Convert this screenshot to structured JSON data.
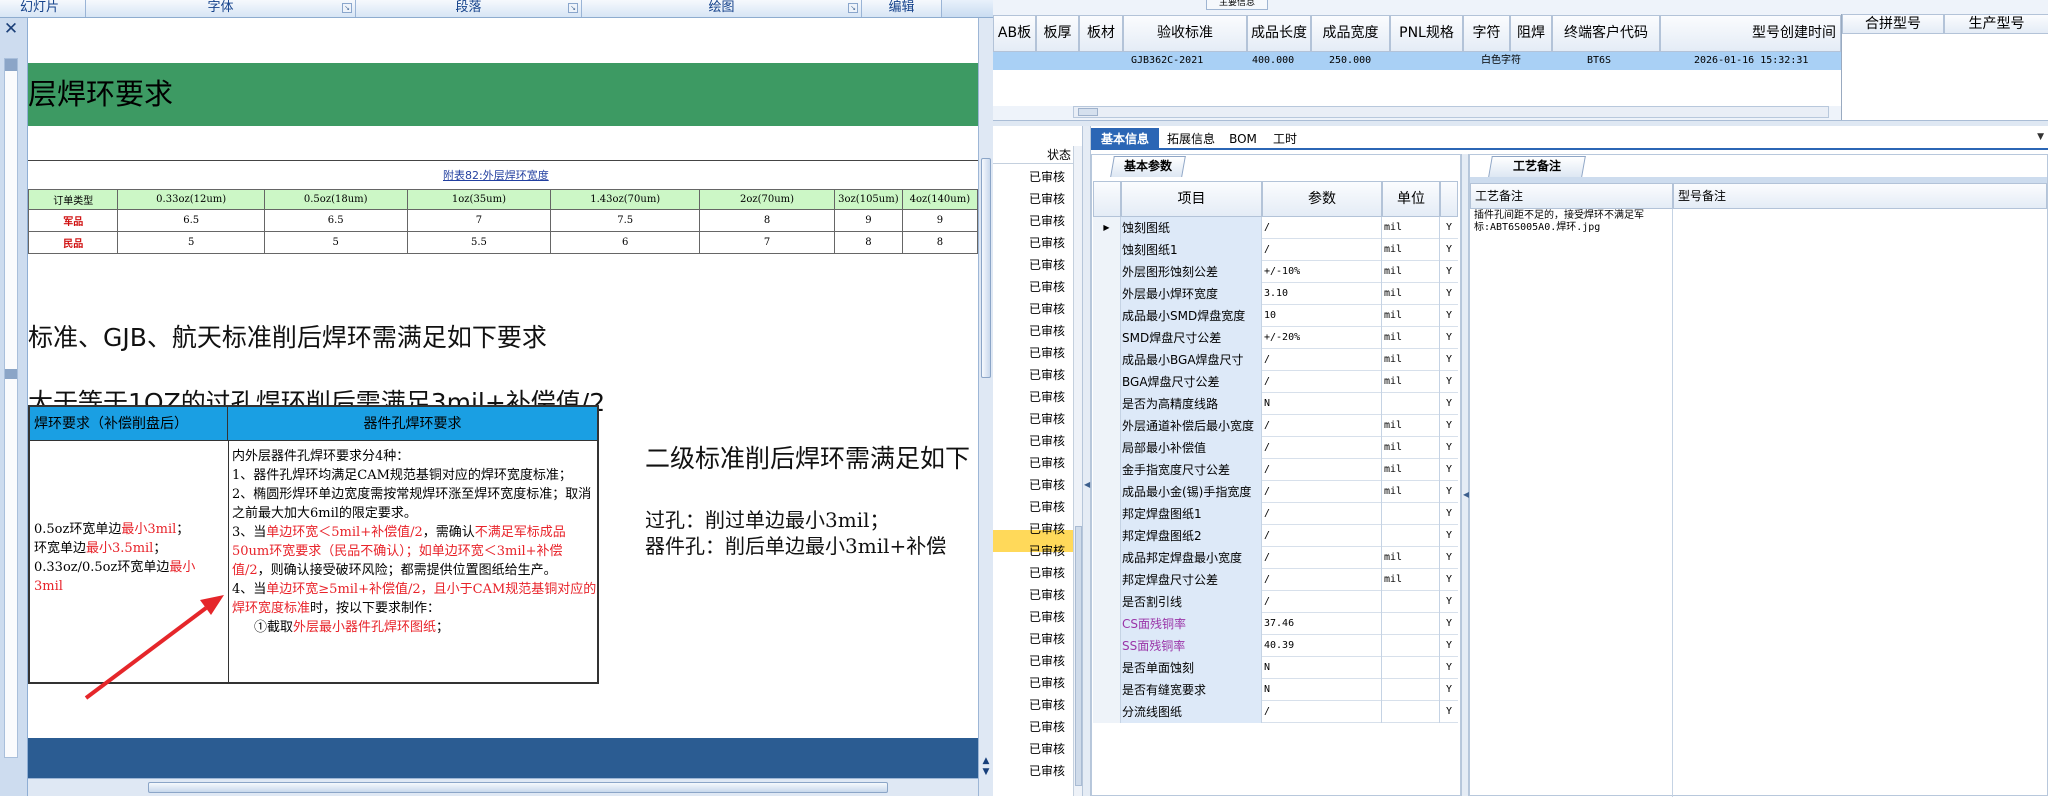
{
  "ribbon": {
    "groups": [
      "幻灯片",
      "字体",
      "段落",
      "绘图",
      "编辑"
    ]
  },
  "doc": {
    "heading": "层焊环要求",
    "table1_title": "附表82:外层焊环宽度",
    "table1": {
      "header": [
        "订单类型",
        "0.33oz(12um)",
        "0.5oz(18um)",
        "1oz(35um)",
        "1.43oz(70um)",
        "2oz(70um)",
        "3oz(105um)",
        "4oz(140um)"
      ],
      "rows": [
        [
          "军品",
          "6.5",
          "6.5",
          "7",
          "7.5",
          "8",
          "9",
          "9"
        ],
        [
          "民品",
          "5",
          "5",
          "5.5",
          "6",
          "7",
          "8",
          "8"
        ]
      ]
    },
    "para1": "标准、GJB、航天标准削后焊环需满足如下要求",
    "para2": "大于等于1OZ的过孔焊环削后需满足3mil+补偿值/2",
    "table2": {
      "head_left": "焊环要求（补偿削盘后）",
      "head_right": "器件孔焊环要求",
      "left_l1a": "0.5oz环宽单边",
      "left_l1b": "最小3mil",
      "left_l1c": "；",
      "left_l2a": "环宽单边",
      "left_l2b": "最小3.5mil",
      "left_l2c": "；",
      "left_l3a": "0.33oz/0.5oz环宽单边",
      "left_l3b": "最小3mil",
      "r1": "内外层器件孔焊环要求分4种：",
      "r2": "1、器件孔焊环均满足CAM规范基铜对应的焊环宽度标准；",
      "r3": "2、椭圆形焊环单边宽度需按常规焊环涨至焊环宽度标准；取消之前最大加大6mil的限定要求。",
      "r4a": "3、当",
      "r4b": "单边环宽＜5mil+补偿值/2",
      "r4c": "，需确认",
      "r4d": "不满足军标成品50um环宽要求（民品不确认）；如单边环宽＜3mil+补偿值/2",
      "r4e": "，则确认接受破环风险；都需提供位置图纸给生产。",
      "r5a": "4、当",
      "r5b": "单边环宽≥5mil+补偿值/2，且小于CAM规范基铜对应的焊环宽度标准",
      "r5c": "时，按以下要求制作：",
      "r6a": "①截取",
      "r6b": "外层最小器件孔焊环图纸",
      "r6c": "；"
    },
    "para3": "二级标准削后焊环需满足如下",
    "para4": "过孔：削过单边最小3mil；",
    "para5": "器件孔：削后单边最小3mil+补偿"
  },
  "erp": {
    "mini_tab": "主要信息",
    "grid_headers": [
      "AB板",
      "板厚",
      "板材",
      "验收标准",
      "成品长度",
      "成品宽度",
      "PNL规格",
      "字符",
      "阻焊",
      "终端客户代码",
      "型号创建时间"
    ],
    "grid_row": {
      "standard": "GJB362C-2021",
      "length": "400.000",
      "width": "250.000",
      "char": "白色字符",
      "customer": "BT6S",
      "created": "2026-01-16 15:32:31"
    },
    "merge_headers": [
      "合拼型号",
      "生产型号"
    ],
    "status_header": "状态",
    "status_value": "已审核",
    "tabs": [
      "基本信息",
      "拓展信息",
      "BOM",
      "工时"
    ],
    "basic_tab": "基本参数",
    "param_headers": [
      "项目",
      "参数",
      "单位"
    ],
    "params": [
      {
        "name": "蚀刻图纸",
        "value": "/",
        "unit": "mil",
        "flag": "Y"
      },
      {
        "name": "蚀刻图纸1",
        "value": "/",
        "unit": "mil",
        "flag": "Y"
      },
      {
        "name": "外层图形蚀刻公差",
        "value": "+/-10%",
        "unit": "mil",
        "flag": "Y"
      },
      {
        "name": "外层最小焊环宽度",
        "value": "3.10",
        "unit": "mil",
        "flag": "Y"
      },
      {
        "name": "成品最小SMD焊盘宽度",
        "value": "10",
        "unit": "mil",
        "flag": "Y"
      },
      {
        "name": "SMD焊盘尺寸公差",
        "value": "+/-20%",
        "unit": "mil",
        "flag": "Y"
      },
      {
        "name": "成品最小BGA焊盘尺寸",
        "value": "/",
        "unit": "mil",
        "flag": "Y"
      },
      {
        "name": "BGA焊盘尺寸公差",
        "value": "/",
        "unit": "mil",
        "flag": "Y"
      },
      {
        "name": "是否为高精度线路",
        "value": "N",
        "unit": "",
        "flag": "Y"
      },
      {
        "name": "外层通道补偿后最小宽度",
        "value": "/",
        "unit": "mil",
        "flag": "Y"
      },
      {
        "name": "局部最小补偿值",
        "value": "/",
        "unit": "mil",
        "flag": "Y"
      },
      {
        "name": "金手指宽度尺寸公差",
        "value": "/",
        "unit": "mil",
        "flag": "Y"
      },
      {
        "name": "成品最小金(锡)手指宽度",
        "value": "/",
        "unit": "mil",
        "flag": "Y"
      },
      {
        "name": "邦定焊盘图纸1",
        "value": "/",
        "unit": "",
        "flag": "Y"
      },
      {
        "name": "邦定焊盘图纸2",
        "value": "/",
        "unit": "",
        "flag": "Y"
      },
      {
        "name": "成品邦定焊盘最小宽度",
        "value": "/",
        "unit": "mil",
        "flag": "Y"
      },
      {
        "name": "邦定焊盘尺寸公差",
        "value": "/",
        "unit": "mil",
        "flag": "Y"
      },
      {
        "name": "是否割引线",
        "value": "/",
        "unit": "",
        "flag": "Y"
      },
      {
        "name": "CS面残铜率",
        "value": "37.46",
        "unit": "",
        "flag": "Y"
      },
      {
        "name": "SS面残铜率",
        "value": "40.39",
        "unit": "",
        "flag": "Y"
      },
      {
        "name": "是否单面蚀刻",
        "value": "N",
        "unit": "",
        "flag": "Y"
      },
      {
        "name": "是否有缝宽要求",
        "value": "N",
        "unit": "",
        "flag": "Y"
      },
      {
        "name": "分流线图纸",
        "value": "/",
        "unit": "",
        "flag": "Y"
      }
    ],
    "craft_tab": "工艺备注",
    "craft_headers": [
      "工艺备注",
      "型号备注"
    ],
    "craft_note": "插件孔间距不足的，接受焊环不满足军标:ABT6S005A0.焊环.jpg"
  }
}
